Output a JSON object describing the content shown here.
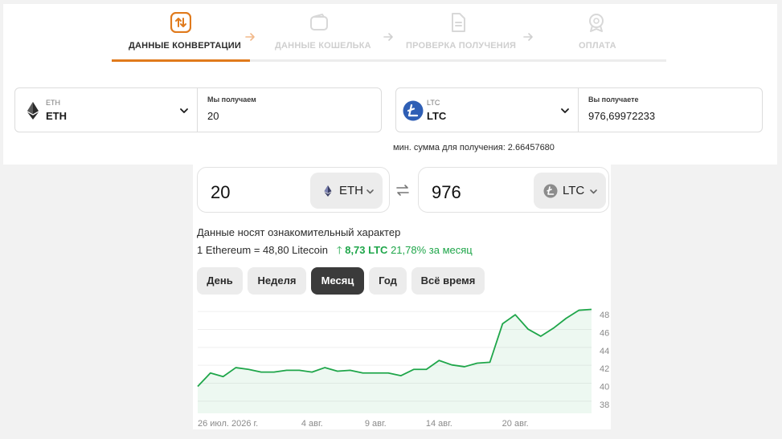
{
  "steps": [
    {
      "label": "ДАННЫЕ КОНВЕРТАЦИИ",
      "icon": "swap-vertical-icon",
      "state": "active"
    },
    {
      "label": "ДАННЫЕ КОШЕЛЬКА",
      "icon": "wallet-icon",
      "state": "inactive"
    },
    {
      "label": "ПРОВЕРКА ПОЛУЧЕНИЯ",
      "icon": "document-icon",
      "state": "inactive"
    },
    {
      "label": "ОПЛАТА",
      "icon": "badge-icon",
      "state": "inactive"
    }
  ],
  "send": {
    "currency_small": "ETH",
    "currency": "ETH",
    "amount_label": "Мы получаем",
    "amount": "20"
  },
  "receive": {
    "currency_small": "LTC",
    "currency": "LTC",
    "amount_label": "Вы получаете",
    "amount": "976,69972233"
  },
  "min_sum": "мин. сумма для получения: 2.66457680",
  "widget": {
    "from_amount": "20",
    "from_currency": "ETH",
    "to_amount": "976",
    "to_currency": "LTC",
    "disclaimer": "Данные носят ознакомительный характер",
    "rate_text": "1 Ethereum = 48,80 Litecoin",
    "change_abs": "8,73 LTC",
    "change_pct": "21,78%",
    "change_period": "за месяц",
    "periods": [
      "День",
      "Неделя",
      "Месяц",
      "Год",
      "Всё время"
    ],
    "active_period": "Месяц"
  },
  "colors": {
    "accent": "#e07a1c",
    "positive": "#1fa64a",
    "active_button": "#3b3b3b"
  },
  "chart_data": {
    "type": "area",
    "y_ticks": [
      38,
      40,
      42,
      44,
      46,
      48
    ],
    "ylim": [
      37,
      49
    ],
    "x_labels": [
      {
        "label": "26 июл. 2026 г.",
        "index": 0
      },
      {
        "label": "4 авг.",
        "index": 9
      },
      {
        "label": "9 авг.",
        "index": 14
      },
      {
        "label": "14 авг.",
        "index": 19
      },
      {
        "label": "20 авг.",
        "index": 25
      }
    ],
    "series": [
      {
        "values": [
          40.0,
          41.5,
          41.1,
          42.1,
          41.9,
          41.6,
          41.6,
          41.8,
          41.8,
          41.6,
          42.1,
          41.7,
          41.8,
          41.5,
          41.5,
          41.5,
          41.2,
          41.9,
          41.9,
          42.9,
          42.4,
          42.2,
          42.6,
          42.7,
          47.0,
          48.0,
          46.4,
          45.6,
          46.5,
          47.6,
          48.5,
          48.6
        ]
      }
    ]
  }
}
